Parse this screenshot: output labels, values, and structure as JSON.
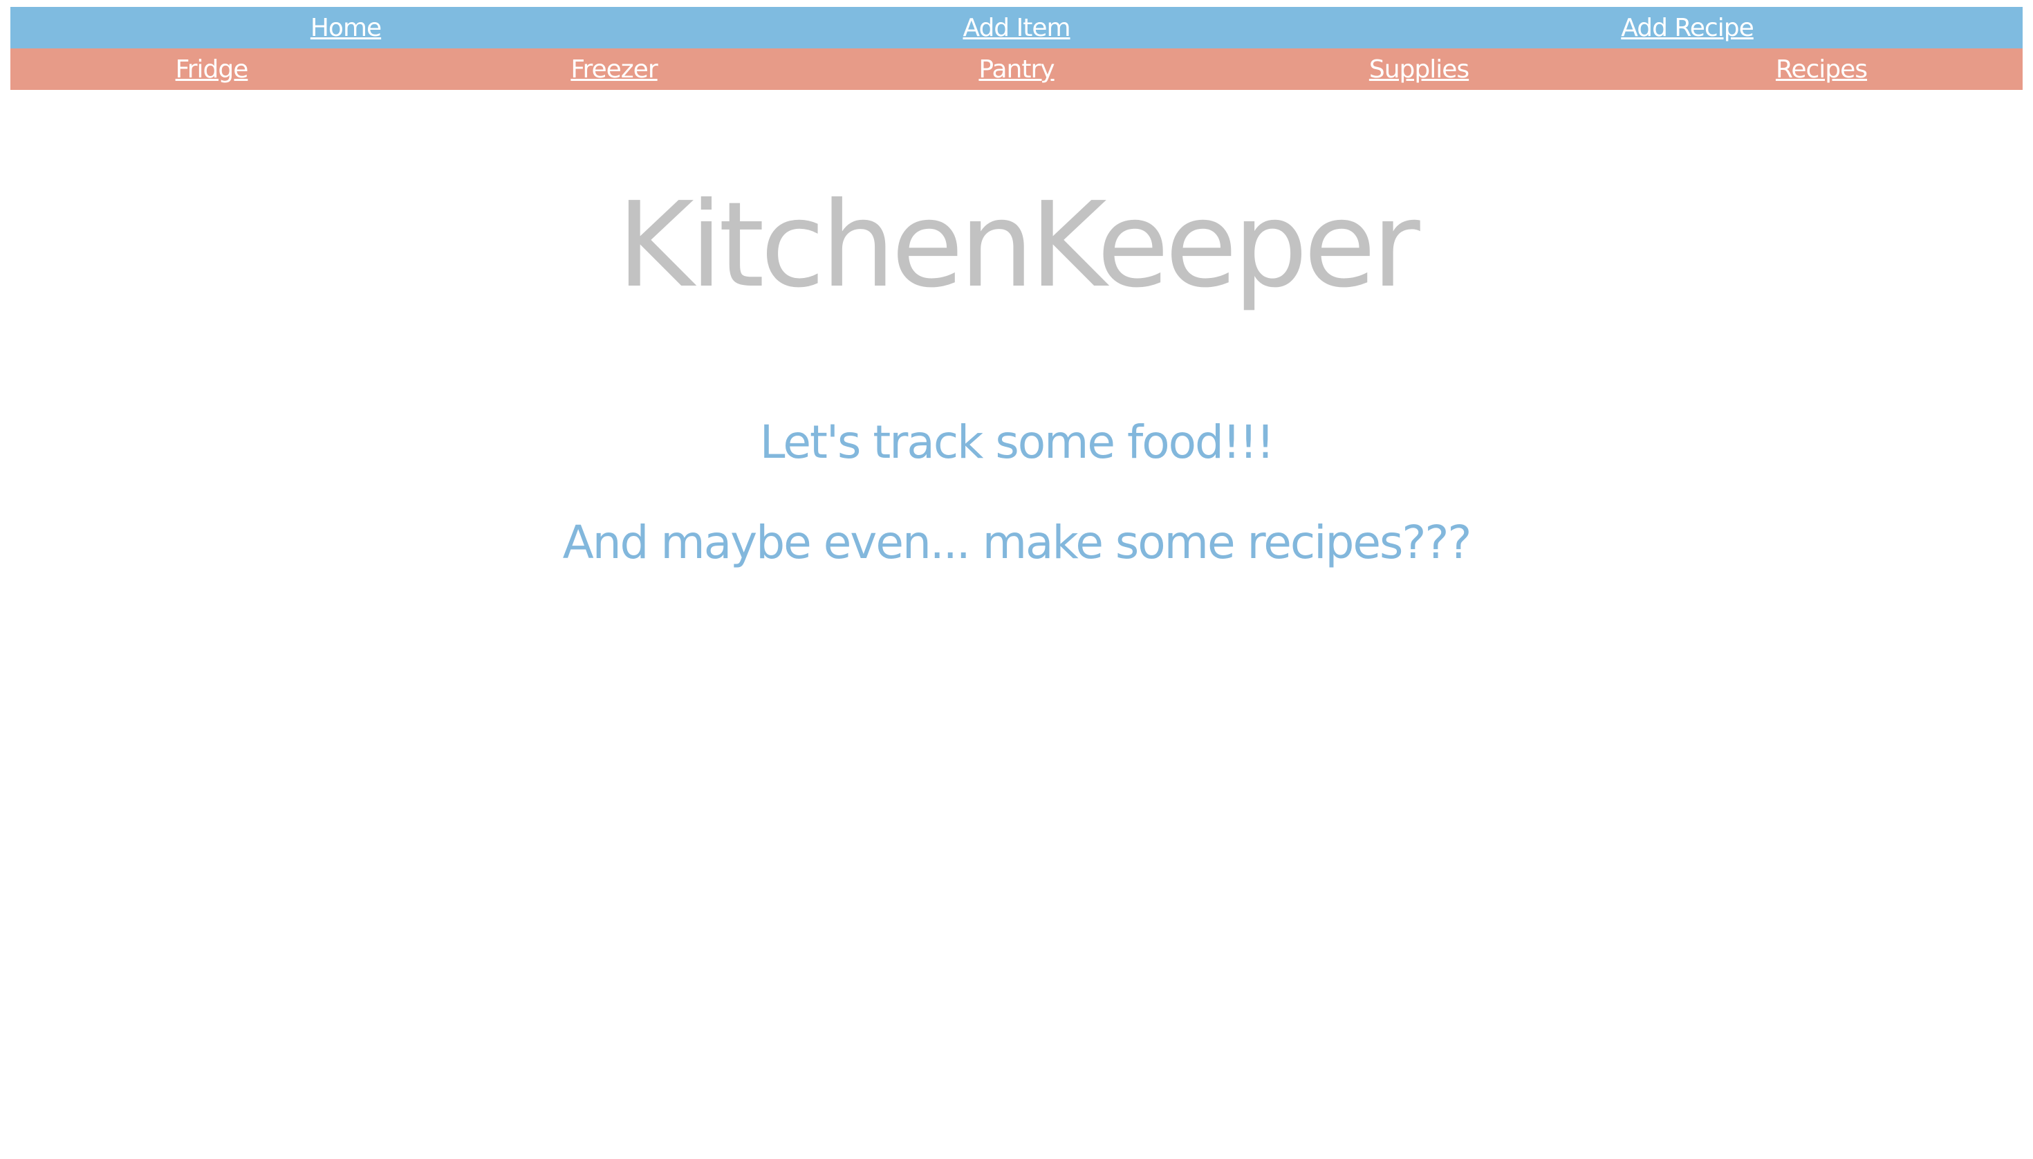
{
  "nav": {
    "primary": {
      "home": "Home",
      "add_item": "Add Item",
      "add_recipe": "Add Recipe"
    },
    "secondary": {
      "fridge": "Fridge",
      "freezer": "Freezer",
      "pantry": "Pantry",
      "supplies": "Supplies",
      "recipes": "Recipes"
    }
  },
  "main": {
    "title": "KitchenKeeper",
    "tagline_1": "Let's track some food!!!",
    "tagline_2": "And maybe even... make some recipes???"
  },
  "colors": {
    "primary_nav_bg": "#7fbbe0",
    "secondary_nav_bg": "#e79b88",
    "title": "#c2c2c2",
    "tagline": "#82b7dc",
    "link": "#ffffff"
  }
}
